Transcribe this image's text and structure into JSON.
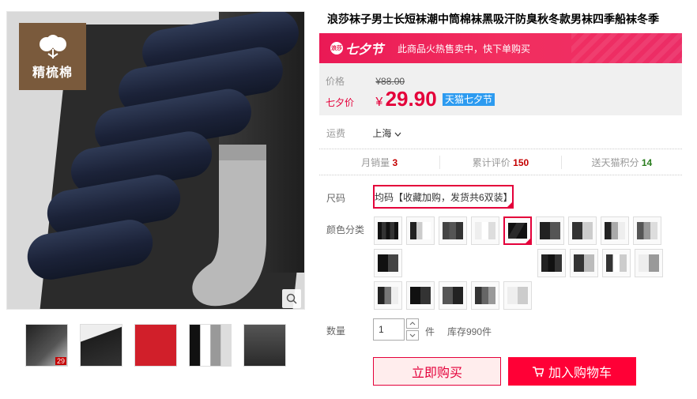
{
  "product": {
    "title": "浪莎袜子男士长短袜潮中筒棉袜黑吸汗防臭秋冬款男袜四季船袜冬季"
  },
  "gallery": {
    "logo_text": "精梳棉",
    "zoom_icon": "magnifier-icon",
    "thumb_tag": "29"
  },
  "promo": {
    "logo_circle": "浪莎",
    "logo_script": "七夕节",
    "banner_text": "此商品火热售卖中，快下单购买"
  },
  "pricing": {
    "orig_label": "价格",
    "orig_price": "¥88.00",
    "sale_label": "七夕价",
    "currency": "¥",
    "sale_price": "29.90",
    "event_tag": "天猫七夕节"
  },
  "shipping": {
    "label": "运费",
    "city": "上海"
  },
  "stats": {
    "monthly_label": "月销量",
    "monthly_value": "3",
    "reviews_label": "累计评价",
    "reviews_value": "150",
    "points_label": "送天猫积分",
    "points_value": "14"
  },
  "sku": {
    "size_label": "尺码",
    "size_option": "均码【收藏加购，发货共6双装】",
    "color_label": "颜色分类",
    "selected_index": 4
  },
  "quantity": {
    "label": "数量",
    "value": "1",
    "unit": "件",
    "stock": "库存990件"
  },
  "actions": {
    "buy_now": "立即购买",
    "add_to_cart": "加入购物车"
  }
}
